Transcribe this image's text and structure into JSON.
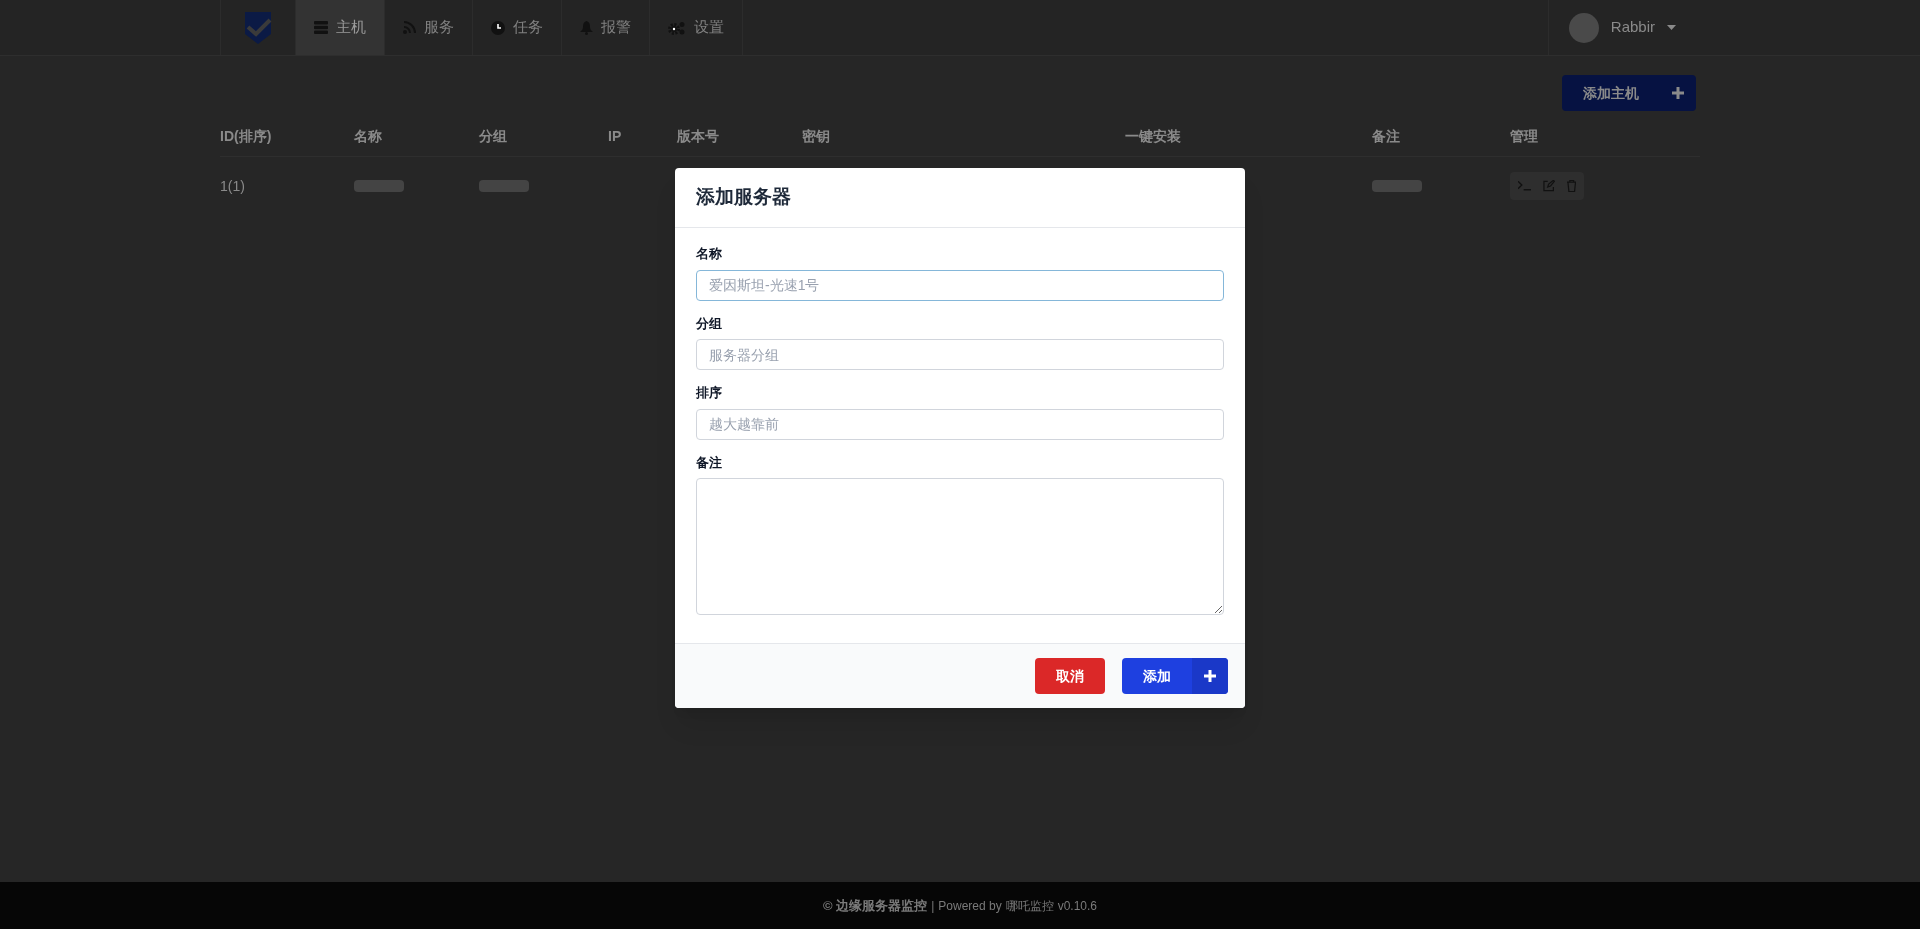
{
  "nav": {
    "items": [
      {
        "label": "主机",
        "selected": true
      },
      {
        "label": "服务",
        "selected": false
      },
      {
        "label": "任务",
        "selected": false
      },
      {
        "label": "报警",
        "selected": false
      },
      {
        "label": "设置",
        "selected": false
      }
    ],
    "user": {
      "name": "Rabbir"
    }
  },
  "add_host_button": {
    "label": "添加主机"
  },
  "table": {
    "columns": [
      "ID(排序)",
      "名称",
      "分组",
      "IP",
      "版本号",
      "密钥",
      "一键安装",
      "备注",
      "管理"
    ],
    "rows": [
      {
        "id": "1(1)"
      }
    ]
  },
  "modal": {
    "title": "添加服务器",
    "fields": [
      {
        "kind": "input",
        "label": "名称",
        "placeholder": "爱因斯坦-光速1号",
        "focused": true
      },
      {
        "kind": "input",
        "label": "分组",
        "placeholder": "服务器分组",
        "focused": false
      },
      {
        "kind": "input",
        "label": "排序",
        "placeholder": "越大越靠前",
        "focused": false
      },
      {
        "kind": "textarea",
        "label": "备注",
        "focused": false
      }
    ],
    "buttons": [
      {
        "kind": "cancel",
        "label": "取消"
      },
      {
        "kind": "submit",
        "label": "添加"
      }
    ]
  },
  "footer": {
    "brand": "© 边缘服务器监控",
    "separator": "|",
    "powered": "Powered by",
    "link": "哪吒监控",
    "version": "v0.10.6"
  }
}
